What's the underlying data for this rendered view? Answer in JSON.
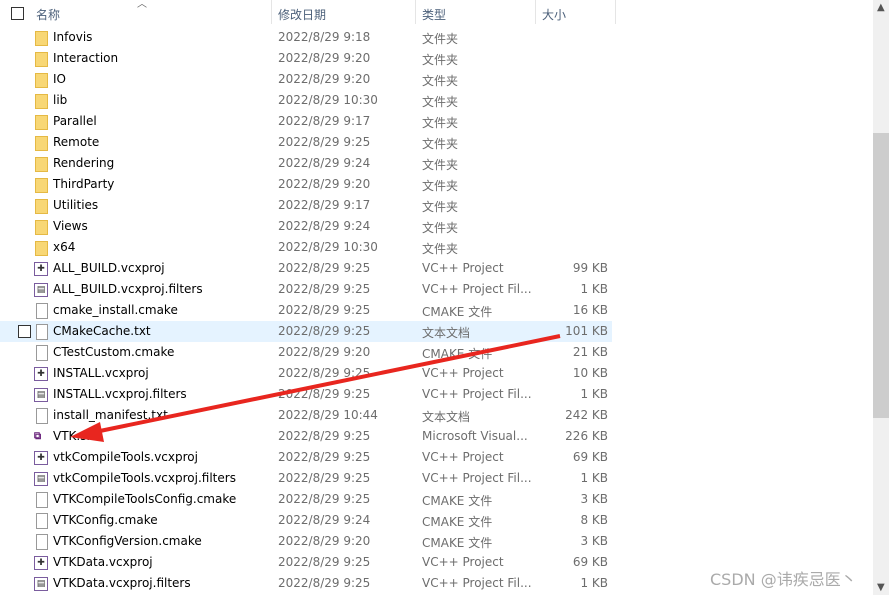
{
  "header": {
    "name": "名称",
    "date": "修改日期",
    "type": "类型",
    "size": "大小"
  },
  "rows": [
    {
      "name": "Infovis",
      "date": "2022/8/29 9:18",
      "type": "文件夹",
      "size": "",
      "icon": "folder"
    },
    {
      "name": "Interaction",
      "date": "2022/8/29 9:20",
      "type": "文件夹",
      "size": "",
      "icon": "folder"
    },
    {
      "name": "IO",
      "date": "2022/8/29 9:20",
      "type": "文件夹",
      "size": "",
      "icon": "folder"
    },
    {
      "name": "lib",
      "date": "2022/8/29 10:30",
      "type": "文件夹",
      "size": "",
      "icon": "folder"
    },
    {
      "name": "Parallel",
      "date": "2022/8/29 9:17",
      "type": "文件夹",
      "size": "",
      "icon": "folder"
    },
    {
      "name": "Remote",
      "date": "2022/8/29 9:25",
      "type": "文件夹",
      "size": "",
      "icon": "folder"
    },
    {
      "name": "Rendering",
      "date": "2022/8/29 9:24",
      "type": "文件夹",
      "size": "",
      "icon": "folder"
    },
    {
      "name": "ThirdParty",
      "date": "2022/8/29 9:20",
      "type": "文件夹",
      "size": "",
      "icon": "folder"
    },
    {
      "name": "Utilities",
      "date": "2022/8/29 9:17",
      "type": "文件夹",
      "size": "",
      "icon": "folder"
    },
    {
      "name": "Views",
      "date": "2022/8/29 9:24",
      "type": "文件夹",
      "size": "",
      "icon": "folder"
    },
    {
      "name": "x64",
      "date": "2022/8/29 10:30",
      "type": "文件夹",
      "size": "",
      "icon": "folder"
    },
    {
      "name": "ALL_BUILD.vcxproj",
      "date": "2022/8/29 9:25",
      "type": "VC++ Project",
      "size": "99 KB",
      "icon": "proj"
    },
    {
      "name": "ALL_BUILD.vcxproj.filters",
      "date": "2022/8/29 9:25",
      "type": "VC++ Project Fil...",
      "size": "1 KB",
      "icon": "filters"
    },
    {
      "name": "cmake_install.cmake",
      "date": "2022/8/29 9:25",
      "type": "CMAKE 文件",
      "size": "16 KB",
      "icon": "file"
    },
    {
      "name": "CMakeCache.txt",
      "date": "2022/8/29 9:25",
      "type": "文本文档",
      "size": "101 KB",
      "icon": "text",
      "hover": true
    },
    {
      "name": "CTestCustom.cmake",
      "date": "2022/8/29 9:20",
      "type": "CMAKE 文件",
      "size": "21 KB",
      "icon": "file"
    },
    {
      "name": "INSTALL.vcxproj",
      "date": "2022/8/29 9:25",
      "type": "VC++ Project",
      "size": "10 KB",
      "icon": "proj"
    },
    {
      "name": "INSTALL.vcxproj.filters",
      "date": "2022/8/29 9:25",
      "type": "VC++ Project Fil...",
      "size": "1 KB",
      "icon": "filters"
    },
    {
      "name": "install_manifest.txt",
      "date": "2022/8/29 10:44",
      "type": "文本文档",
      "size": "242 KB",
      "icon": "text"
    },
    {
      "name": "VTK.sln",
      "date": "2022/8/29 9:25",
      "type": "Microsoft Visual...",
      "size": "226 KB",
      "icon": "sln"
    },
    {
      "name": "vtkCompileTools.vcxproj",
      "date": "2022/8/29 9:25",
      "type": "VC++ Project",
      "size": "69 KB",
      "icon": "proj"
    },
    {
      "name": "vtkCompileTools.vcxproj.filters",
      "date": "2022/8/29 9:25",
      "type": "VC++ Project Fil...",
      "size": "1 KB",
      "icon": "filters"
    },
    {
      "name": "VTKCompileToolsConfig.cmake",
      "date": "2022/8/29 9:25",
      "type": "CMAKE 文件",
      "size": "3 KB",
      "icon": "file"
    },
    {
      "name": "VTKConfig.cmake",
      "date": "2022/8/29 9:24",
      "type": "CMAKE 文件",
      "size": "8 KB",
      "icon": "file"
    },
    {
      "name": "VTKConfigVersion.cmake",
      "date": "2022/8/29 9:20",
      "type": "CMAKE 文件",
      "size": "3 KB",
      "icon": "file"
    },
    {
      "name": "VTKData.vcxproj",
      "date": "2022/8/29 9:25",
      "type": "VC++ Project",
      "size": "69 KB",
      "icon": "proj"
    },
    {
      "name": "VTKData.vcxproj.filters",
      "date": "2022/8/29 9:25",
      "type": "VC++ Project Fil...",
      "size": "1 KB",
      "icon": "filters"
    }
  ],
  "watermark": "CSDN @讳疾忌医丶",
  "colors": {
    "arrow": "#e8261f",
    "hover": "#e5f3ff",
    "folder": "#f8d775"
  }
}
